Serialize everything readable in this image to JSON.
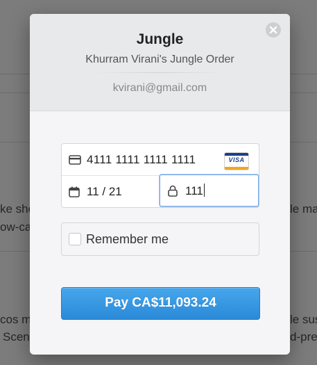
{
  "background": {
    "lines": [
      "ke sho",
      "le ma",
      "ow-ca",
      "cos m",
      "le sus",
      "Scen",
      "d-pre"
    ]
  },
  "modal": {
    "title": "Jungle",
    "subtitle": "Khurram Virani's Jungle Order",
    "email": "kvirani@gmail.com",
    "close_icon": "close-icon"
  },
  "card": {
    "number": "4111 1111 1111 1111",
    "brand": "VISA",
    "expiry": "11 / 21",
    "cvc": "111",
    "icons": {
      "card": "credit-card-icon",
      "calendar": "calendar-icon",
      "lock": "lock-icon",
      "brand": "visa-logo"
    }
  },
  "remember": {
    "label": "Remember me",
    "checked": false
  },
  "pay_button": {
    "label": "Pay CA$11,093.24"
  },
  "colors": {
    "pay_button": "#3498e1",
    "modal_header": "#e8e9eb",
    "focus_ring": "#7aa8e6"
  }
}
